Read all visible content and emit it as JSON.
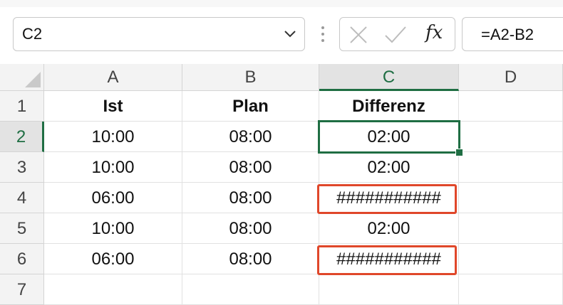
{
  "name_box": {
    "value": "C2"
  },
  "formula_bar": {
    "formula": "=A2-B2",
    "fx_label": "fx"
  },
  "columns": [
    "A",
    "B",
    "C",
    "D"
  ],
  "selected_column": "C",
  "rows": [
    {
      "num": "1",
      "cells": [
        "Ist",
        "Plan",
        "Differenz",
        ""
      ],
      "header": true
    },
    {
      "num": "2",
      "cells": [
        "10:00",
        "08:00",
        "02:00",
        ""
      ]
    },
    {
      "num": "3",
      "cells": [
        "10:00",
        "08:00",
        "02:00",
        ""
      ]
    },
    {
      "num": "4",
      "cells": [
        "06:00",
        "08:00",
        "###########",
        ""
      ]
    },
    {
      "num": "5",
      "cells": [
        "10:00",
        "08:00",
        "02:00",
        ""
      ]
    },
    {
      "num": "6",
      "cells": [
        "06:00",
        "08:00",
        "###########",
        ""
      ]
    },
    {
      "num": "7",
      "cells": [
        "",
        "",
        "",
        ""
      ]
    }
  ],
  "selected_row": "2",
  "active_cell": "C2",
  "highlighted_cells": [
    "C4",
    "C6"
  ],
  "colors": {
    "accent": "#1f6e43",
    "highlight": "#e0472a"
  },
  "icons": [
    "dropdown-arrow-icon",
    "cancel-icon",
    "enter-check-icon",
    "insert-function-icon"
  ]
}
